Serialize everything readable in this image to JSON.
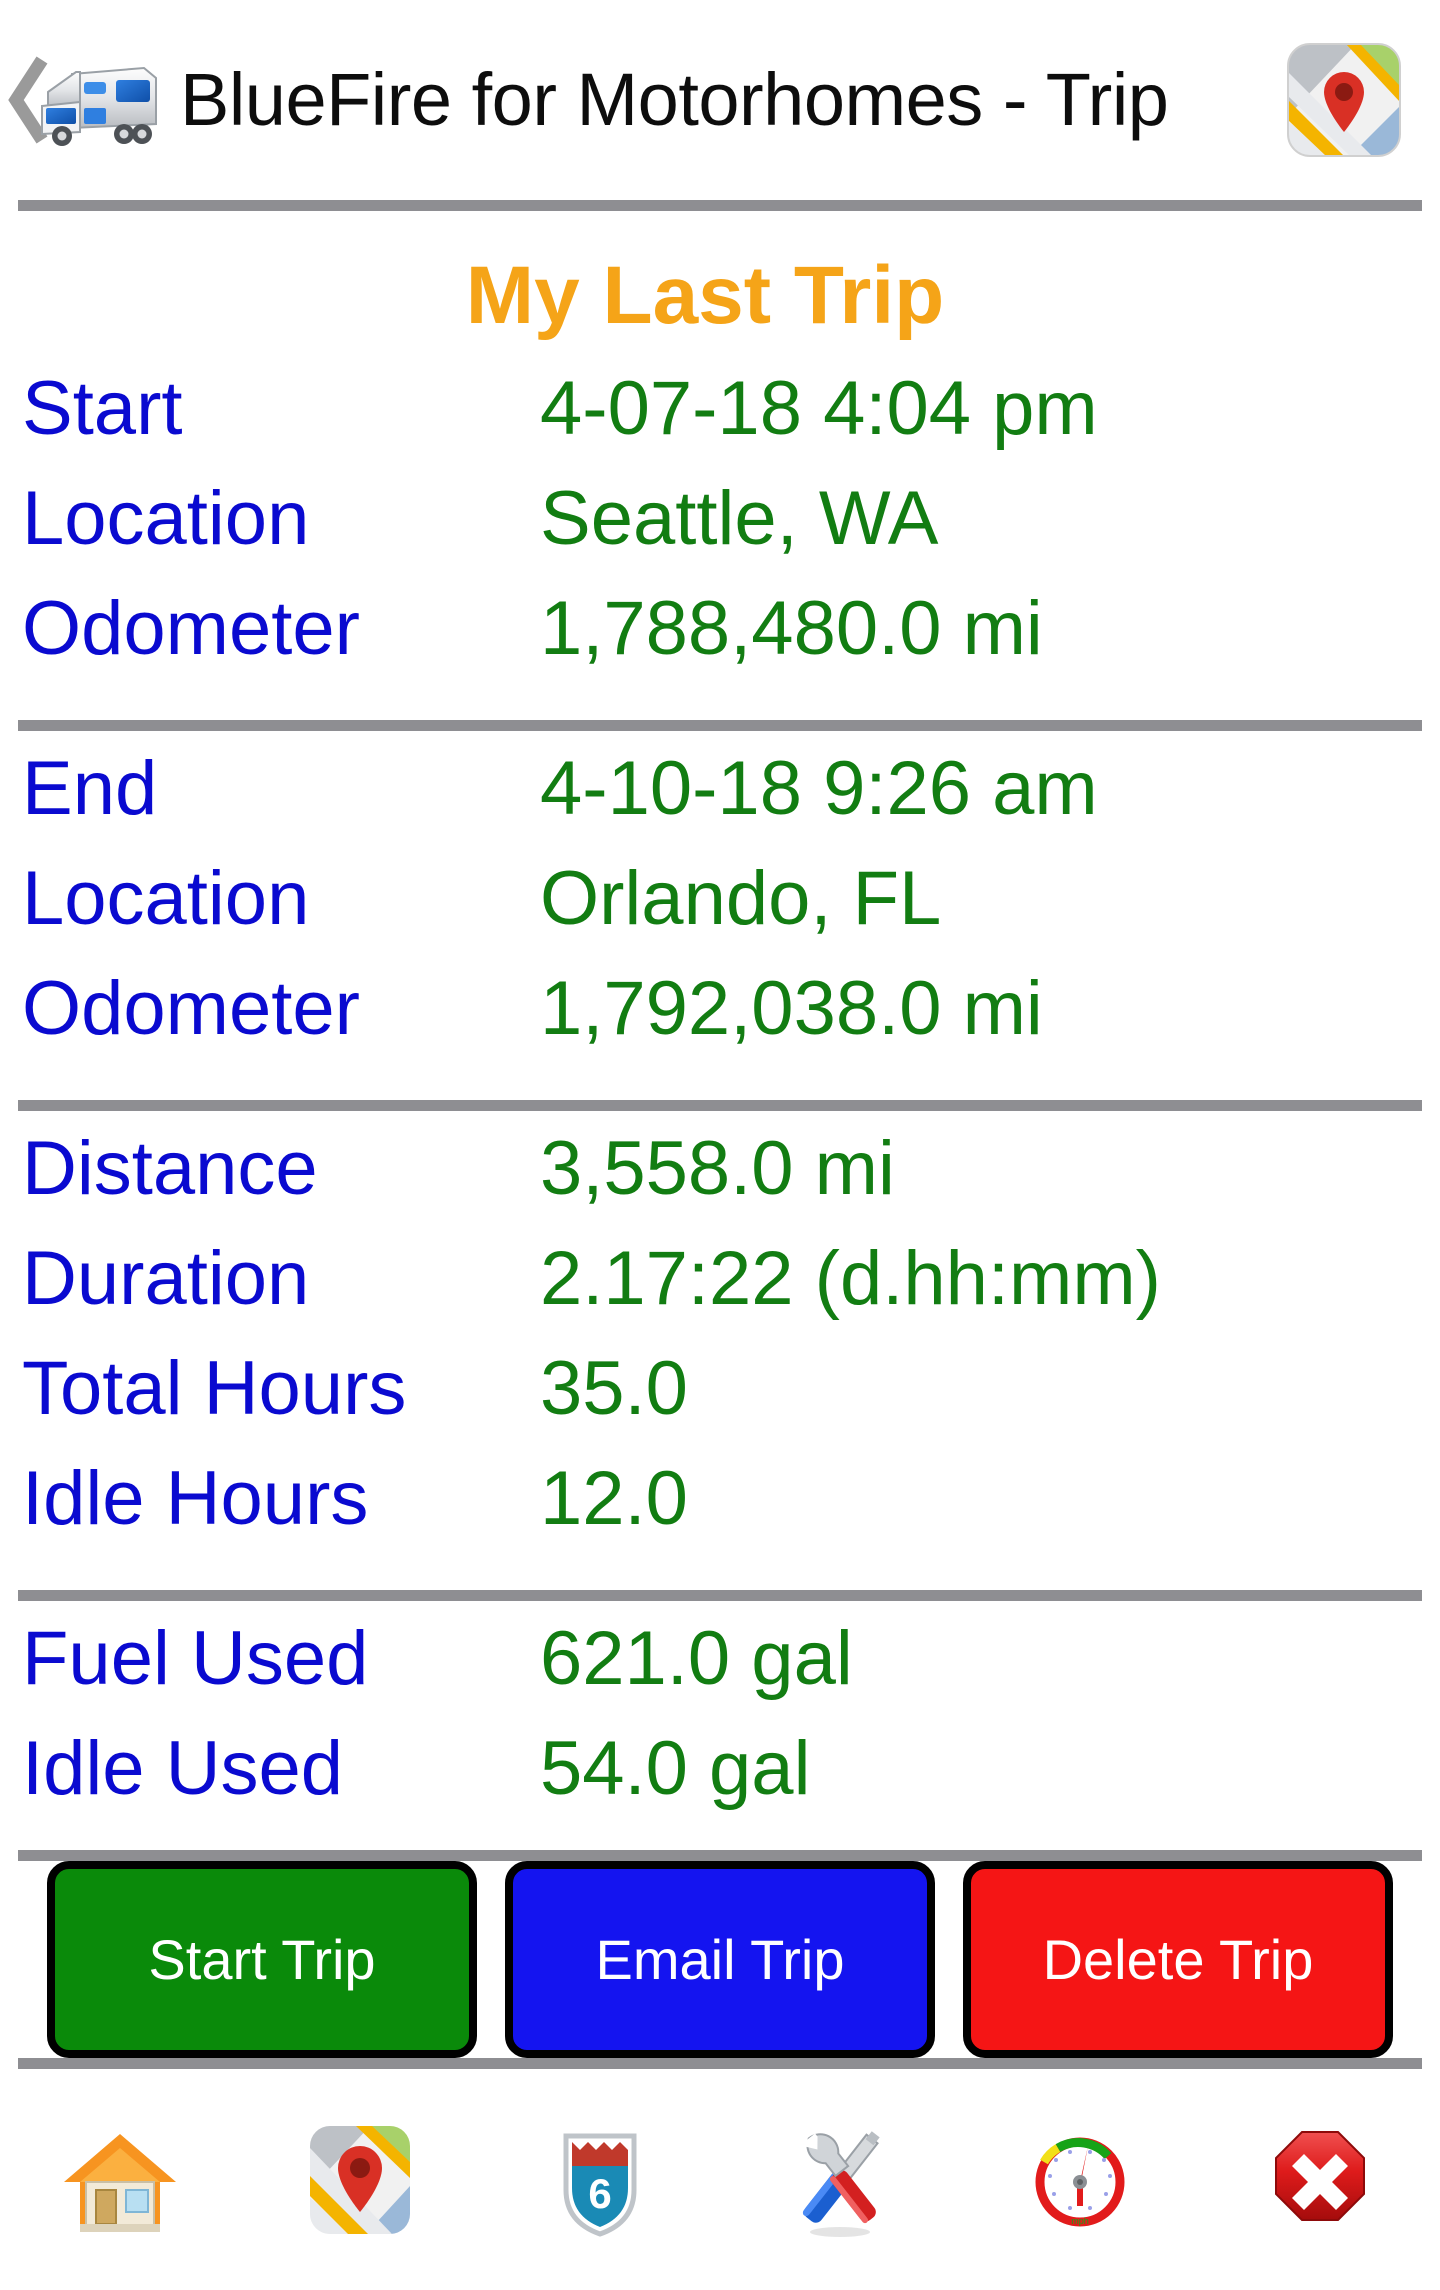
{
  "header": {
    "back_icon": "back-chevron-icon",
    "app_icon": "motorhome-icon",
    "title": "BlueFire for Motorhomes - Trip",
    "right_icon": "maps-icon"
  },
  "main": {
    "title": "My Last Trip",
    "groups": [
      {
        "name": "start-group",
        "rows": [
          {
            "label": "Start",
            "value": "4-07-18 4:04 pm"
          },
          {
            "label": "Location",
            "value": "Seattle, WA"
          },
          {
            "label": "Odometer",
            "value": "1,788,480.0 mi"
          }
        ]
      },
      {
        "name": "end-group",
        "rows": [
          {
            "label": "End",
            "value": "4-10-18 9:26 am"
          },
          {
            "label": "Location",
            "value": "Orlando, FL"
          },
          {
            "label": "Odometer",
            "value": "1,792,038.0 mi"
          }
        ]
      },
      {
        "name": "summary-group",
        "rows": [
          {
            "label": "Distance",
            "value": "3,558.0 mi"
          },
          {
            "label": "Duration",
            "value": "2.17:22 (d.hh:mm)"
          },
          {
            "label": "Total Hours",
            "value": "35.0"
          },
          {
            "label": "Idle Hours",
            "value": "12.0"
          }
        ]
      },
      {
        "name": "fuel-group",
        "rows": [
          {
            "label": "Fuel Used",
            "value": "621.0 gal"
          },
          {
            "label": "Idle Used",
            "value": "54.0 gal"
          }
        ]
      }
    ]
  },
  "buttons": [
    {
      "name": "start-trip-button",
      "label": "Start Trip",
      "color": "#0a8a0a"
    },
    {
      "name": "email-trip-button",
      "label": "Email Trip",
      "color": "#1414f0"
    },
    {
      "name": "delete-trip-button",
      "label": "Delete Trip",
      "color": "#f51515"
    }
  ],
  "toolbar": [
    {
      "name": "home-icon",
      "label": "home"
    },
    {
      "name": "map-pin-icon",
      "label": "map"
    },
    {
      "name": "highway-shield-icon",
      "label": "6"
    },
    {
      "name": "tools-icon",
      "label": "tools"
    },
    {
      "name": "gauge-icon",
      "label": "gauge"
    },
    {
      "name": "close-icon",
      "label": "close"
    }
  ],
  "colors": {
    "label": "#0a0ad0",
    "value": "#127d12",
    "title": "#f5a418",
    "divider": "#8e8e92"
  }
}
